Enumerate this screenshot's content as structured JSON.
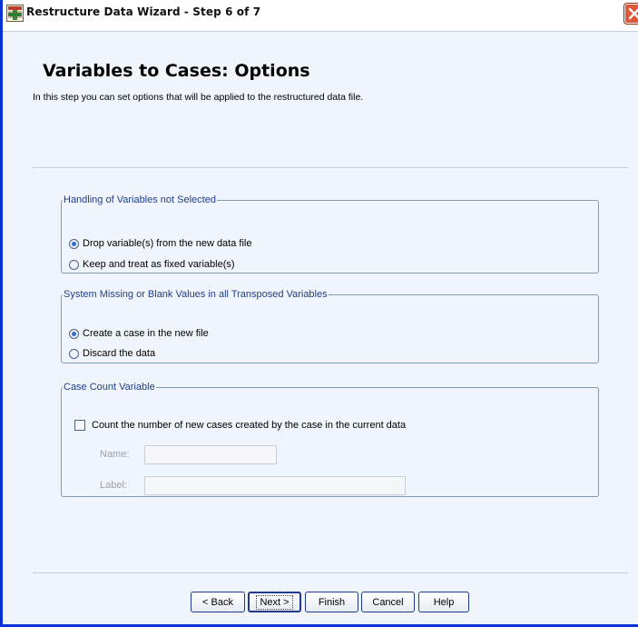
{
  "window": {
    "title": "Restructure Data Wizard - Step 6 of 7"
  },
  "page": {
    "title": "Variables to Cases: Options",
    "description": "In this step you can set options that will be applied to the restructured data file."
  },
  "groups": {
    "handling": {
      "legend": "Handling of Variables not Selected",
      "options": [
        {
          "label": "Drop variable(s) from the new data file",
          "selected": true
        },
        {
          "label": "Keep and treat as fixed variable(s)",
          "selected": false
        }
      ]
    },
    "missing": {
      "legend": "System Missing or Blank Values in all Transposed Variables",
      "options": [
        {
          "label": "Create a case in the new file",
          "selected": true
        },
        {
          "label": "Discard the data",
          "selected": false
        }
      ]
    },
    "case_count": {
      "legend": "Case Count Variable",
      "checkbox_label": "Count the number of new cases created by the case in the current data",
      "checked": false,
      "name_label": "Name:",
      "name_value": "",
      "label_label": "Label:",
      "label_value": ""
    }
  },
  "buttons": {
    "back": "< Back",
    "next": "Next >",
    "finish": "Finish",
    "cancel": "Cancel",
    "help": "Help"
  },
  "colors": {
    "window_border": "#0831d9",
    "close_button": "#e0573a",
    "group_legend": "#1f3f8c",
    "dialog_background": "#f0f4fb"
  }
}
